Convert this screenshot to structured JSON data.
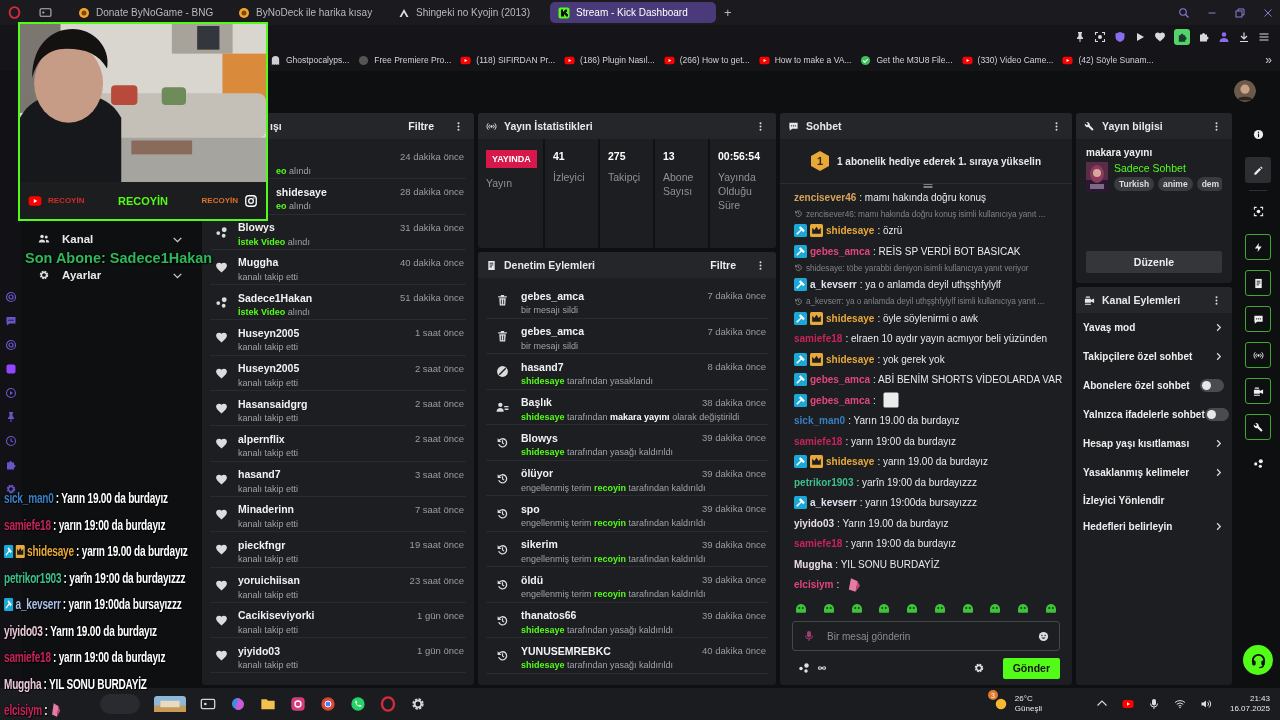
{
  "browser": {
    "tabs": [
      {
        "label": "Donate ByNoGame - BNG",
        "selected": false
      },
      {
        "label": "ByNoDeck ile harika kısay",
        "selected": false
      },
      {
        "label": "Shingeki no Kyojin (2013)",
        "selected": false
      },
      {
        "label": "Stream - Kick Dashboard",
        "selected": true
      }
    ],
    "new_tab": "+",
    "bookmarks": [
      {
        "label": "Ghostpocalyps..."
      },
      {
        "label": "Free Premiere Pro..."
      },
      {
        "label": "(118) SIFIRDAN Pr..."
      },
      {
        "label": "(186) Plugin Nasıl..."
      },
      {
        "label": "(266) How to get..."
      },
      {
        "label": "How to make a VA..."
      },
      {
        "label": "Get the M3U8 File..."
      },
      {
        "label": "(330) Video Came..."
      },
      {
        "label": "(42) Söyle Sunam..."
      }
    ],
    "bookmarks_more": "»"
  },
  "left_nav": {
    "items": [
      {
        "label": "Kanal",
        "expanded": false
      },
      {
        "label": "Ayarlar",
        "expanded": false
      }
    ]
  },
  "activity": {
    "title": "ışı",
    "filter": "Filtre",
    "items": [
      {
        "covered": true,
        "kind": "request",
        "time": "24 dakika önce",
        "sub": [
          {
            "text": "eo",
            "kind": "reward"
          },
          {
            "text": " alındı",
            "kind": "plain"
          }
        ]
      },
      {
        "covered": true,
        "kind": "request",
        "name": "shidesaye",
        "time": "28 dakika önce",
        "sub": [
          {
            "text": "eo",
            "kind": "reward"
          },
          {
            "text": " alındı",
            "kind": "plain"
          }
        ]
      },
      {
        "covered": false,
        "kind": "request",
        "name": "Blowys",
        "time": "31 dakika önce",
        "sub": [
          {
            "text": "İstek Video",
            "kind": "reward"
          },
          {
            "text": " alındı",
            "kind": "plain"
          }
        ]
      },
      {
        "covered": false,
        "kind": "follow",
        "name": "Muggha",
        "time": "40 dakika önce",
        "sub": [
          {
            "text": "kanalı takip etti",
            "kind": "plain"
          }
        ]
      },
      {
        "covered": false,
        "kind": "request",
        "name": "Sadece1Hakan",
        "time": "51 dakika önce",
        "sub": [
          {
            "text": "İstek Video",
            "kind": "reward"
          },
          {
            "text": " alındı",
            "kind": "plain"
          }
        ]
      },
      {
        "covered": false,
        "kind": "follow",
        "name": "Huseyn2005",
        "time": "1 saat önce",
        "sub": [
          {
            "text": "kanalı takip etti",
            "kind": "plain"
          }
        ]
      },
      {
        "covered": false,
        "kind": "follow",
        "name": "Huseyn2005",
        "time": "2 saat önce",
        "sub": [
          {
            "text": "kanalı takip etti",
            "kind": "plain"
          }
        ]
      },
      {
        "covered": false,
        "kind": "follow",
        "name": "Hasansaidgrg",
        "time": "2 saat önce",
        "sub": [
          {
            "text": "kanalı takip etti",
            "kind": "plain"
          }
        ]
      },
      {
        "covered": false,
        "kind": "follow",
        "name": "alpernflix",
        "time": "2 saat önce",
        "sub": [
          {
            "text": "kanalı takip etti",
            "kind": "plain"
          }
        ]
      },
      {
        "covered": false,
        "kind": "follow",
        "name": "hasand7",
        "time": "3 saat önce",
        "sub": [
          {
            "text": "kanalı takip etti",
            "kind": "plain"
          }
        ]
      },
      {
        "covered": false,
        "kind": "follow",
        "name": "Minaderinn",
        "time": "7 saat önce",
        "sub": [
          {
            "text": "kanalı takip etti",
            "kind": "plain"
          }
        ]
      },
      {
        "covered": false,
        "kind": "follow",
        "name": "pieckfngr",
        "time": "19 saat önce",
        "sub": [
          {
            "text": "kanalı takip etti",
            "kind": "plain"
          }
        ]
      },
      {
        "covered": false,
        "kind": "follow",
        "name": "yoruichiisan",
        "time": "23 saat önce",
        "sub": [
          {
            "text": "kanalı takip etti",
            "kind": "plain"
          }
        ]
      },
      {
        "covered": false,
        "kind": "follow",
        "name": "Cacikiseviyorki",
        "time": "1 gün önce",
        "sub": [
          {
            "text": "kanalı takip etti",
            "kind": "plain"
          }
        ]
      },
      {
        "covered": false,
        "kind": "follow",
        "name": "yiyido03",
        "time": "1 gün önce",
        "sub": [
          {
            "text": "kanalı takip etti",
            "kind": "plain"
          }
        ]
      }
    ]
  },
  "stats": {
    "title": "Yayın İstatistikleri",
    "live_badge": "YAYINDA",
    "items": [
      {
        "label": "Yayın",
        "kind": "live"
      },
      {
        "value": "41",
        "label": "İzleyici",
        "kind": "number"
      },
      {
        "value": "275",
        "label": "Takipçi",
        "kind": "number"
      },
      {
        "value": "13",
        "label": "Abone Sayısı",
        "kind": "number"
      },
      {
        "value": "00:56:54",
        "label": "Yayında Olduğu Süre",
        "kind": "number"
      }
    ]
  },
  "moderation": {
    "title": "Denetim Eylemleri",
    "filter": "Filtre",
    "items": [
      {
        "kind": "delete",
        "name": "gebes_amca",
        "time": "7 dakika önce",
        "sub": [
          {
            "text": "bir mesajı sildi",
            "kind": "plain"
          }
        ]
      },
      {
        "kind": "delete",
        "name": "gebes_amca",
        "time": "7 dakika önce",
        "sub": [
          {
            "text": "bir mesajı sildi",
            "kind": "plain"
          }
        ]
      },
      {
        "kind": "ban",
        "name": "hasand7",
        "time": "8 dakika önce",
        "sub": [
          {
            "text": "shidesaye",
            "kind": "user"
          },
          {
            "text": " tarafından yasaklandı",
            "kind": "plain"
          }
        ]
      },
      {
        "kind": "title",
        "name": "Başlık",
        "time": "38 dakika önce",
        "sub": [
          {
            "text": "shidesaye",
            "kind": "user"
          },
          {
            "text": " tarafından ",
            "kind": "plain"
          },
          {
            "text": "makara yayını",
            "kind": "newvalue"
          },
          {
            "text": " olarak değiştirildi",
            "kind": "plain"
          }
        ]
      },
      {
        "kind": "undo",
        "name": "Blowys",
        "time": "39 dakika önce",
        "sub": [
          {
            "text": "shidesaye",
            "kind": "user"
          },
          {
            "text": " tarafından yasağı kaldırıldı",
            "kind": "plain"
          }
        ]
      },
      {
        "kind": "undo",
        "name": "ölüyor",
        "time": "39 dakika önce",
        "sub": [
          {
            "text": "engellenmiş terim ",
            "kind": "plain"
          },
          {
            "text": "recoyin",
            "kind": "user"
          },
          {
            "text": " tarafından kaldırıldı",
            "kind": "plain"
          }
        ]
      },
      {
        "kind": "undo",
        "name": "spo",
        "time": "39 dakika önce",
        "sub": [
          {
            "text": "engellenmiş terim ",
            "kind": "plain"
          },
          {
            "text": "recoyin",
            "kind": "user"
          },
          {
            "text": " tarafından kaldırıldı",
            "kind": "plain"
          }
        ]
      },
      {
        "kind": "undo",
        "name": "sikerim",
        "time": "39 dakika önce",
        "sub": [
          {
            "text": "engellenmiş terim ",
            "kind": "plain"
          },
          {
            "text": "recoyin",
            "kind": "user"
          },
          {
            "text": " tarafından kaldırıldı",
            "kind": "plain"
          }
        ]
      },
      {
        "kind": "undo",
        "name": "öldü",
        "time": "39 dakika önce",
        "sub": [
          {
            "text": "engellenmiş terim ",
            "kind": "plain"
          },
          {
            "text": "recoyin",
            "kind": "user"
          },
          {
            "text": " tarafından kaldırıldı",
            "kind": "plain"
          }
        ]
      },
      {
        "kind": "undo",
        "name": "thanatos66",
        "time": "39 dakika önce",
        "sub": [
          {
            "text": "shidesaye",
            "kind": "user"
          },
          {
            "text": " tarafından yasağı kaldırıldı",
            "kind": "plain"
          }
        ]
      },
      {
        "kind": "undo",
        "name": "YUNUSEMREBKC",
        "time": "40 dakika önce",
        "sub": [
          {
            "text": "shidesaye",
            "kind": "user"
          },
          {
            "text": " tarafından yasağı kaldırıldı",
            "kind": "plain"
          }
        ]
      }
    ]
  },
  "chat": {
    "title": "Sohbet",
    "pinned_rank": "1",
    "pinned_text": "1 abonelik hediye ederek 1. sıraya yükselin",
    "messages": [
      {
        "kind": "message",
        "user": "zencisever46",
        "color": "#d9a35a",
        "moderator": false,
        "subscriber": false,
        "text": ": mamı hakında doğru konuş"
      },
      {
        "kind": "reply",
        "text": "zencisever46: mamı hakında doğru konuş isimli kullanıcıya yanıt ..."
      },
      {
        "kind": "message",
        "user": "shidesaye",
        "color": "#e9a93a",
        "moderator": true,
        "subscriber": true,
        "text": ": özrü"
      },
      {
        "kind": "message",
        "user": "gebes_amca",
        "color": "#e0457b",
        "moderator": true,
        "subscriber": false,
        "text": ": REİS SP VERDİ BOT BASICAK"
      },
      {
        "kind": "reply",
        "text": "shidesaye: töbe yarabbi deniyon isimli kullanıcıya yanıt veriyor"
      },
      {
        "kind": "message",
        "user": "a_kevserr",
        "color": "#dfe3f0",
        "moderator": true,
        "subscriber": false,
        "text": ": ya o anlamda deyil uthşşhfylylf"
      },
      {
        "kind": "reply",
        "text": "a_kevserr: ya o anlamda deyil uthşşhfylylf isimli kullanıcıya yanıt ..."
      },
      {
        "kind": "message",
        "user": "shidesaye",
        "color": "#e9a93a",
        "moderator": true,
        "subscriber": true,
        "text": ": öyle söylenirmi o awk"
      },
      {
        "kind": "message",
        "user": "samiefe18",
        "color": "#c8245a",
        "moderator": false,
        "subscriber": false,
        "text": ": elraen 10 aydır yayın acmıyor beli yüzünden"
      },
      {
        "kind": "message",
        "user": "shidesaye",
        "color": "#e9a93a",
        "moderator": true,
        "subscriber": true,
        "text": ": yok gerek yok"
      },
      {
        "kind": "message",
        "user": "gebes_amca",
        "color": "#e0457b",
        "moderator": true,
        "subscriber": false,
        "text": ": ABİ BENİM SHORTS VİDEOLARDA VAR"
      },
      {
        "kind": "blankemote",
        "user": "gebes_amca",
        "color": "#e0457b",
        "moderator": true,
        "subscriber": false,
        "text": ":"
      },
      {
        "kind": "message",
        "user": "sick_man0",
        "color": "#3a7fc4",
        "moderator": false,
        "subscriber": false,
        "text": ": Yarın 19.00 da burdayız"
      },
      {
        "kind": "message",
        "user": "samiefe18",
        "color": "#c8245a",
        "moderator": false,
        "subscriber": false,
        "text": ": yarın 19:00 da burdayız"
      },
      {
        "kind": "message",
        "user": "shidesaye",
        "color": "#e9a93a",
        "moderator": true,
        "subscriber": true,
        "text": ": yarın 19.00 da burdayız"
      },
      {
        "kind": "message",
        "user": "petrikor1903",
        "color": "#3cc08a",
        "moderator": false,
        "subscriber": false,
        "text": ": yarîn 19:00 da burdayızzz"
      },
      {
        "kind": "message",
        "user": "a_kevserr",
        "color": "#dfe3f0",
        "moderator": true,
        "subscriber": false,
        "text": ": yarın 19:00da bursayızzz"
      },
      {
        "kind": "message",
        "user": "yiyido03",
        "color": "#e8dde2",
        "moderator": false,
        "subscriber": false,
        "text": ": Yarın 19.00 da burdayız"
      },
      {
        "kind": "message",
        "user": "samiefe18",
        "color": "#c8245a",
        "moderator": false,
        "subscriber": false,
        "text": ": yarın 19:00 da burdayız"
      },
      {
        "kind": "message",
        "user": "Muggha",
        "color": "#e8dde2",
        "moderator": false,
        "subscriber": false,
        "text": ": YIL SONU BURDAYİZ"
      },
      {
        "kind": "sticker",
        "user": "elcisiym",
        "color": "#e0457b",
        "moderator": false,
        "subscriber": false,
        "text": ":"
      }
    ],
    "input": {
      "placeholder": "Bir mesaj gönderin"
    },
    "send": "Gönder"
  },
  "stream_info": {
    "title": "Yayın bilgisi",
    "stream_title": "makara yayını",
    "category": "Sadece Sohbet",
    "tags": [
      "Turkish",
      "anime",
      "dem"
    ],
    "edit": "Düzenle"
  },
  "channel_actions": {
    "title": "Kanal Eylemleri",
    "items": [
      {
        "label": "Yavaş mod",
        "kind": "link"
      },
      {
        "label": "Takipçilere özel sohbet",
        "kind": "link"
      },
      {
        "label": "Abonelere özel sohbet",
        "kind": "toggle",
        "on": false
      },
      {
        "label": "Yalnızca ifadelerle sohbet",
        "kind": "toggle",
        "on": false
      },
      {
        "label": "Hesap yaşı kısıtlaması",
        "kind": "link"
      },
      {
        "label": "Yasaklanmış kelimeler",
        "kind": "link"
      },
      {
        "label": "İzleyici Yönlendir",
        "kind": "plain"
      },
      {
        "label": "Hedefleri belirleyin",
        "kind": "link"
      }
    ]
  },
  "rail": [
    {
      "selected": false,
      "pinned": false
    },
    {
      "selected": true,
      "pinned": false
    },
    {
      "selected": false,
      "pinned": false
    },
    {
      "selected": false,
      "pinned": true
    },
    {
      "selected": false,
      "pinned": true
    },
    {
      "selected": false,
      "pinned": true
    },
    {
      "selected": false,
      "pinned": true
    },
    {
      "selected": false,
      "pinned": true
    },
    {
      "selected": false,
      "pinned": true
    },
    {
      "selected": false,
      "pinned": false
    }
  ],
  "webcam_overlay": {
    "title": "RECOYİN",
    "left_label": "RECOYİN",
    "right_label": "RECOYİN"
  },
  "last_sub": "Son Abone: Sadece1Hakan",
  "overlay_chat": [
    {
      "kind": "message",
      "user": "sick_man0",
      "color": "#3a7fc4",
      "moderator": false,
      "subscriber": false,
      "text": ": Yarın 19.00 da burdayız"
    },
    {
      "kind": "message",
      "user": "samiefe18",
      "color": "#c8245a",
      "moderator": false,
      "subscriber": false,
      "text": ": yarın 19:00 da burdayız"
    },
    {
      "kind": "message",
      "user": "shidesaye",
      "color": "#e9a93a",
      "moderator": true,
      "subscriber": true,
      "text": ": yarın 19.00 da burdayız"
    },
    {
      "kind": "message",
      "user": "petrikor1903",
      "color": "#3cc08a",
      "moderator": false,
      "subscriber": false,
      "text": ": yarîn 19:00 da burdayızzz"
    },
    {
      "kind": "message",
      "user": "a_kevserr",
      "color": "#a8c0e8",
      "moderator": true,
      "subscriber": false,
      "text": ": yarın 19:00da bursayızzz"
    },
    {
      "kind": "message",
      "user": "yiyido03",
      "color": "#e8c8d8",
      "moderator": false,
      "subscriber": false,
      "text": ": Yarın 19.00 da burdayız"
    },
    {
      "kind": "message",
      "user": "samiefe18",
      "color": "#c8245a",
      "moderator": false,
      "subscriber": false,
      "text": ": yarın 19:00 da burdayız"
    },
    {
      "kind": "message",
      "user": "Muggha",
      "color": "#e8c8d8",
      "moderator": false,
      "subscriber": false,
      "text": ": YIL SONU BURDAYİZ"
    },
    {
      "kind": "sticker",
      "user": "elcisiym",
      "color": "#c8245a",
      "moderator": false,
      "subscriber": false,
      "text": ":"
    }
  ],
  "taskbar": {
    "weather_badge": "3",
    "temperature": "26°C",
    "weather": "Güneşli",
    "time": "21:43",
    "date": "16.07.2025"
  }
}
